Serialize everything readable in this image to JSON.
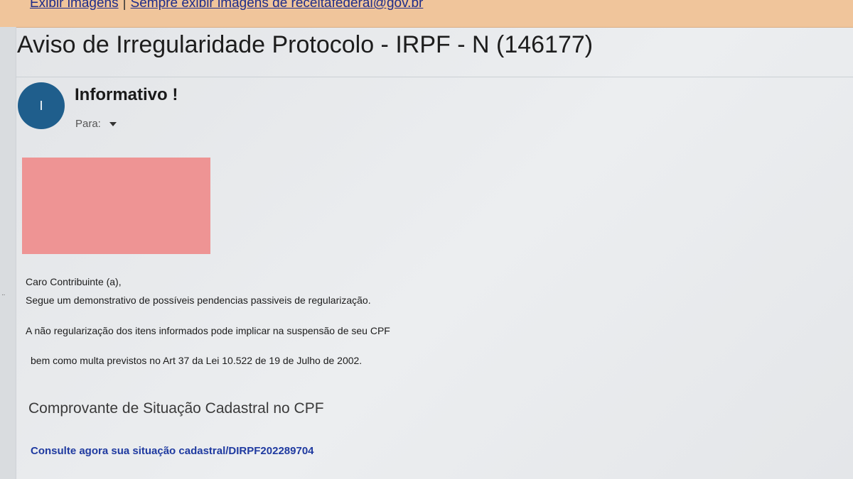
{
  "images_bar": {
    "show_images_label": "Exibir imagens",
    "separator": "|",
    "always_show_label": "Sempre exibir imagens de receitafederal@gov.br"
  },
  "email": {
    "subject": "Aviso de Irregularidade Protocolo - IRPF - N (146177)",
    "sender": {
      "avatar_letter": "I",
      "name": "Informativo !",
      "to_label": "Para:"
    },
    "body": {
      "greeting": "Caro Contribuinte (a),",
      "line1": "Segue um demonstrativo de possíveis pendencias passiveis de regularização.",
      "line2": "A não regularização dos itens informados pode implicar na suspensão de seu CPF",
      "line3": "bem como multa previstos no Art 37 da Lei 10.522 de 19 de Julho de 2002.",
      "section_heading": "Comprovante de Situação Cadastral no CPF",
      "link_text": "Consulte agora sua situação cadastral/DIRPF202289704"
    }
  },
  "colors": {
    "images_bar_bg": "#f0c59b",
    "avatar_bg": "#1f5e8c",
    "banner_bg": "#ee9494",
    "link": "#1f3aa0"
  }
}
